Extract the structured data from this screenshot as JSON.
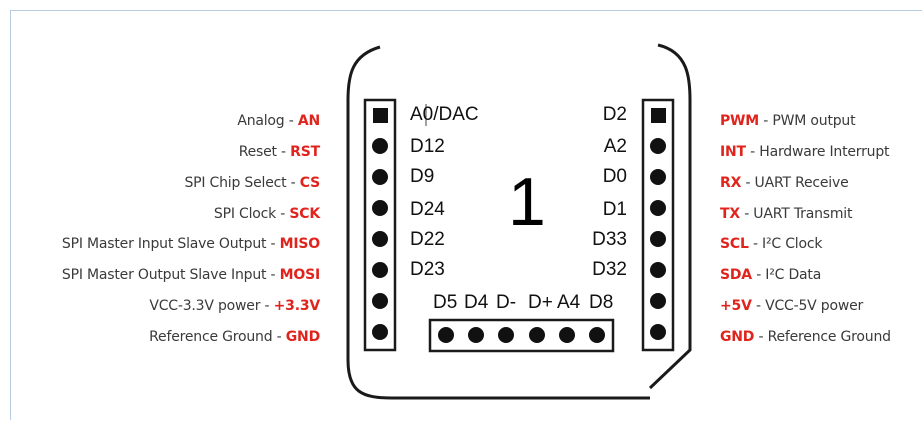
{
  "board": {
    "number": "1",
    "left_header_labels": [
      "A0/DAC",
      "D12",
      "D9",
      "D24",
      "D22",
      "D23"
    ],
    "right_header_labels": [
      "D2",
      "A2",
      "D0",
      "D1",
      "D33",
      "D32"
    ],
    "bottom_header_labels": [
      "D5",
      "D4",
      "D-",
      "D+",
      "A4",
      "D8"
    ]
  },
  "left_pins": [
    {
      "text": "Analog - ",
      "code": "AN"
    },
    {
      "text": "Reset - ",
      "code": "RST"
    },
    {
      "text": "SPI Chip Select  - ",
      "code": "CS"
    },
    {
      "text": "SPI Clock - ",
      "code": "SCK"
    },
    {
      "text": "SPI Master Input Slave Output - ",
      "code": "MISO"
    },
    {
      "text": "SPI Master Output Slave Input - ",
      "code": "MOSI"
    },
    {
      "text": "VCC-3.3V power  - ",
      "code": "+3.3V"
    },
    {
      "text": "Reference Ground - ",
      "code": "GND"
    }
  ],
  "right_pins": [
    {
      "code": "PWM",
      "text": " - PWM output"
    },
    {
      "code": "INT",
      "text": " - Hardware Interrupt"
    },
    {
      "code": "RX",
      "text": " - UART Receive"
    },
    {
      "code": "TX",
      "text": " - UART Transmit"
    },
    {
      "code": "SCL",
      "text": " - I²C Clock"
    },
    {
      "code": "SDA",
      "text": " - I²C Data"
    },
    {
      "code": "+5V",
      "text": " - VCC-5V power"
    },
    {
      "code": "GND",
      "text": " - Reference Ground"
    }
  ],
  "colors": {
    "code": "#e0241d",
    "label": "#3a3a3a",
    "outline": "#1a1a1a"
  }
}
